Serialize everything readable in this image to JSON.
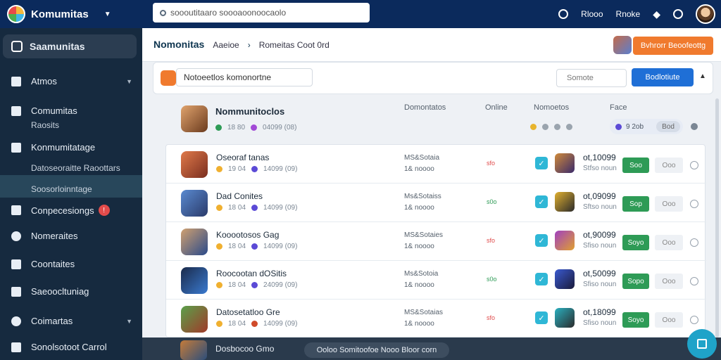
{
  "app": {
    "name": "Komumitas"
  },
  "search": {
    "value": "soooutitaaro soooaoonoocaolo",
    "placeholder": "soooutitaaro soooaoonoocaolo"
  },
  "topbar": {
    "links": [
      "Rlooo",
      "Rnoke"
    ]
  },
  "sidebar": {
    "header": "Saamunitas",
    "items": [
      {
        "label": "Atmos",
        "sub": ""
      },
      {
        "label": "Comumitas",
        "sub": "Raosits"
      },
      {
        "label": "Konmumitatage",
        "sub": "Datoseoraitte Raoottars"
      },
      {
        "label": "Soosorloinntage",
        "sub": ""
      },
      {
        "label": "Conpecesiongs",
        "sub": ""
      },
      {
        "label": "Nomeraites",
        "sub": ""
      },
      {
        "label": "Coontaites",
        "sub": ""
      },
      {
        "label": "Saeoocltuniag",
        "sub": ""
      },
      {
        "label": "Coimartas",
        "sub": ""
      },
      {
        "label": "Sonolsotoot Carrol",
        "sub": ""
      }
    ]
  },
  "header": {
    "title": "Nomonitas",
    "crumb1": "Aaeioe",
    "crumb2": "Romeitas  Coot  0rd",
    "cta": "Bvhrorr Beoofeottg"
  },
  "filter": {
    "input_value": "Notoeetlos komonortne",
    "sort": "Somote",
    "button": "Bodlotiute"
  },
  "columns": {
    "game": "Nommunitoclos",
    "desc": "Domontatos",
    "online": "Online",
    "members": "Nomoetos",
    "price": "Face"
  },
  "header_row": {
    "meta1": "18  80",
    "meta2": "04099 (08)",
    "pill": "9 2ob",
    "pill_btn": "Bod"
  },
  "rows": [
    {
      "name": "Oseoraf tanas",
      "meta1": "19  04",
      "meta2": "14099 (09)",
      "desc1": "MS&Sotaia",
      "desc2": "1& noooo",
      "online": "sfo",
      "val1": "ot,10099",
      "val2": "Stfso noun",
      "join": "Soo",
      "more": "Ooo"
    },
    {
      "name": "Dad  Conites",
      "meta1": "18  04",
      "meta2": "14099 (09)",
      "desc1": "Ms&Sotaiss",
      "desc2": "1& noooo",
      "online": "s0o",
      "val1": "ot,09099",
      "val2": "Sftso noun",
      "join": "Sop",
      "more": "Ooo"
    },
    {
      "name": "Kooootosos  Gag",
      "meta1": "18  04",
      "meta2": "14099 (09)",
      "desc1": "MS&Sotaies",
      "desc2": "1& noooo",
      "online": "sfo",
      "val1": "ot,90099",
      "val2": "Sfiso noun",
      "join": "Soyo",
      "more": "Ooo"
    },
    {
      "name": "Roocootan  dOSitis",
      "meta1": "18  04",
      "meta2": "24099 (09)",
      "desc1": "Ms&Sotoia",
      "desc2": "1& noooo",
      "online": "s0o",
      "val1": "ot,50099",
      "val2": "Sfiso noun",
      "join": "Sopo",
      "more": "Ooo"
    },
    {
      "name": "Datosetatloo Gre",
      "meta1": "18  04",
      "meta2": "14099 (09)",
      "desc1": "MS&Sotaias",
      "desc2": "1& noooo",
      "online": "sfo",
      "val1": "ot,18099",
      "val2": "Sfiso noun",
      "join": "Soyo",
      "more": "Ooo"
    }
  ],
  "bottom": {
    "name": "Dosbocoo  Gmo",
    "toast": "Ooloo  Somitoofoe Nooo Bloor corn"
  },
  "colors": {
    "topbar": "#0b2a5c",
    "sidebar": "#162a3f",
    "accent": "#f07a2e",
    "primary": "#1f6fd6",
    "join": "#2e9b56"
  }
}
